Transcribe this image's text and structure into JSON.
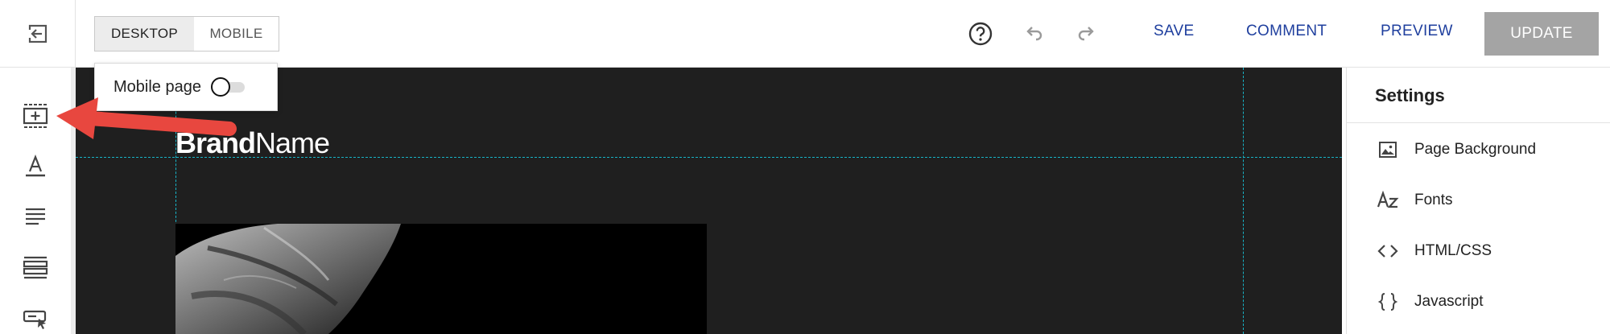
{
  "topbar": {
    "exit_icon": "exit-arrow-icon",
    "view_toggle": {
      "desktop": "DESKTOP",
      "mobile": "MOBILE",
      "selected": "DESKTOP"
    },
    "help_icon": "help-circle-icon",
    "undo_icon": "undo-icon",
    "redo_icon": "redo-icon",
    "save": "SAVE",
    "comment": "COMMENT",
    "preview": "PREVIEW",
    "update": "UPDATE"
  },
  "mobile_popup": {
    "label": "Mobile page",
    "enabled": false
  },
  "left_toolbar": {
    "items": [
      {
        "icon": "add-section-icon"
      },
      {
        "icon": "text-style-icon"
      },
      {
        "icon": "paragraph-icon"
      },
      {
        "icon": "layout-rows-icon"
      },
      {
        "icon": "button-element-icon"
      }
    ]
  },
  "canvas": {
    "brand_bold": "Brand",
    "brand_light": "Name"
  },
  "settings": {
    "title": "Settings",
    "items": [
      {
        "label": "Page Background",
        "icon": "image-icon"
      },
      {
        "label": "Fonts",
        "icon": "fonts-icon"
      },
      {
        "label": "HTML/CSS",
        "icon": "code-icon"
      },
      {
        "label": "Javascript",
        "icon": "braces-icon"
      }
    ]
  },
  "colors": {
    "accent_link": "#1f3f9e",
    "update_button": "#a4a4a4",
    "canvas_bg": "#1f1f1f",
    "guide": "#17b3c6",
    "annotation_arrow": "#e8473f"
  }
}
